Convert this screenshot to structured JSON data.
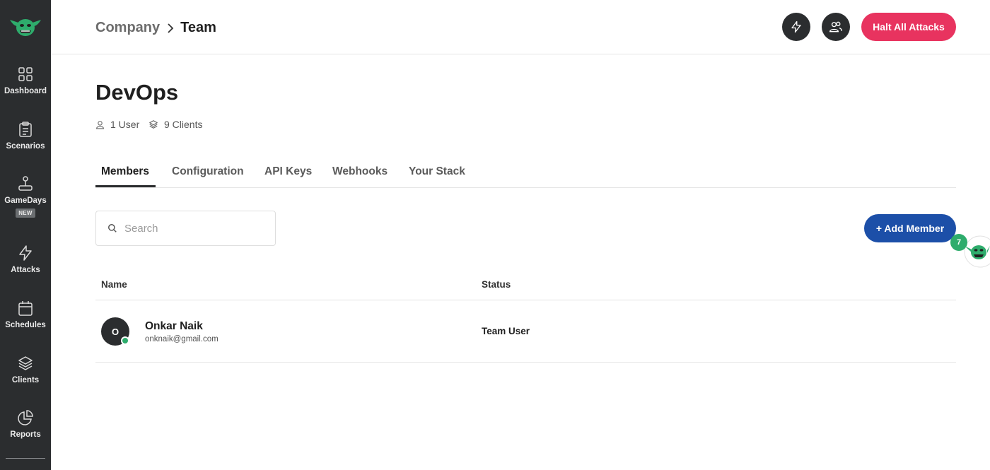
{
  "sidebar": {
    "items": [
      {
        "label": "Dashboard",
        "icon": "dashboard-grid-icon"
      },
      {
        "label": "Scenarios",
        "icon": "clipboard-icon"
      },
      {
        "label": "GameDays",
        "icon": "joystick-icon",
        "badge": "NEW"
      },
      {
        "label": "Attacks",
        "icon": "lightning-icon"
      },
      {
        "label": "Schedules",
        "icon": "calendar-icon"
      },
      {
        "label": "Clients",
        "icon": "layers-icon"
      },
      {
        "label": "Reports",
        "icon": "pie-chart-icon"
      }
    ]
  },
  "header": {
    "breadcrumb": {
      "parent": "Company",
      "current": "Team"
    },
    "halt_label": "Halt All Attacks"
  },
  "team": {
    "title": "DevOps",
    "users": "1 User",
    "clients": "9 Clients"
  },
  "tabs": [
    {
      "label": "Members",
      "active": true
    },
    {
      "label": "Configuration"
    },
    {
      "label": "API Keys"
    },
    {
      "label": "Webhooks"
    },
    {
      "label": "Your Stack"
    }
  ],
  "search": {
    "placeholder": "Search"
  },
  "add_member_label": "+ Add Member",
  "floating_widget": {
    "count": "7"
  },
  "table": {
    "columns": [
      "Name",
      "Status"
    ],
    "rows": [
      {
        "initial": "O",
        "name": "Onkar Naik",
        "email": "onknaik@gmail.com",
        "status": "Team User"
      }
    ]
  },
  "colors": {
    "sidebar_bg": "#2b2d2f",
    "halt_button": "#e8335f",
    "add_button": "#1c4fa8",
    "online": "#2eac6c"
  }
}
